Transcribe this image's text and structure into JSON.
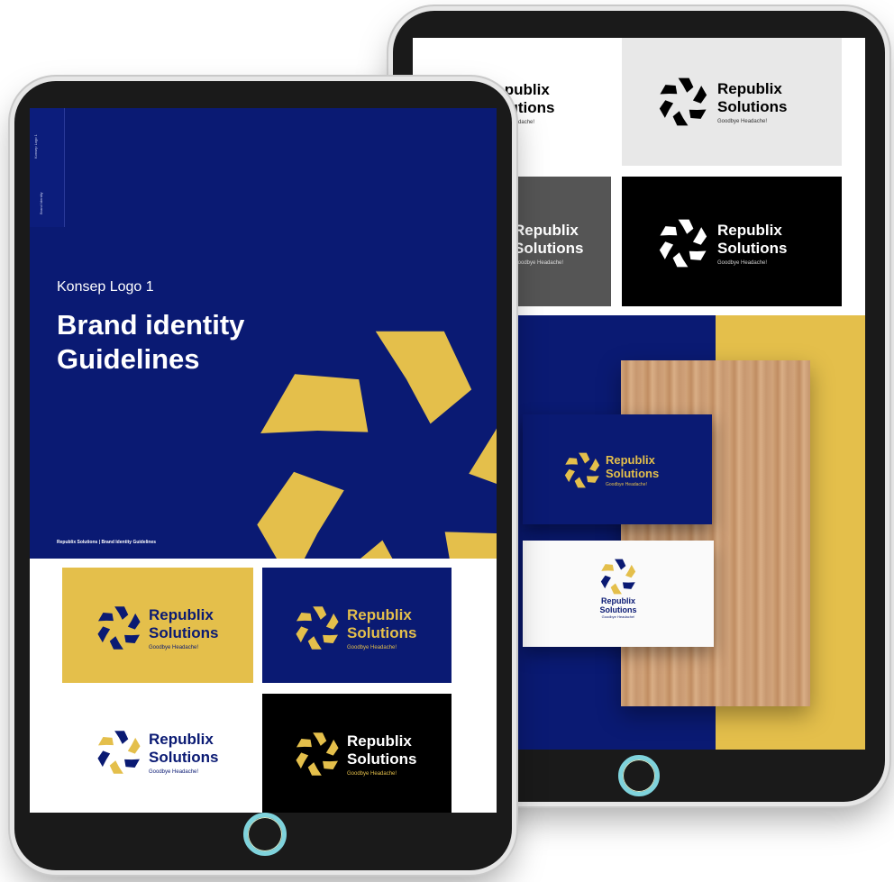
{
  "cover": {
    "concept": "Konsep Logo 1",
    "title": "Brand identity\nGuidelines",
    "footer": "Republix Solutions | Brand Identity Guidelines",
    "side_top": "Konsep Logo 1",
    "side_bottom": "Brand Identity"
  },
  "brand": {
    "line1": "Republix",
    "line2": "Solutions",
    "tagline": "Goodbye Headache!",
    "tagline_short": "Goodbye Headache!"
  },
  "colors": {
    "navy": "#0a1a73",
    "yellow": "#e4bf4b",
    "black": "#000000",
    "white": "#ffffff",
    "light_gray": "#e8e8e8",
    "dark_gray": "#555555",
    "wood": "#c99a70"
  }
}
